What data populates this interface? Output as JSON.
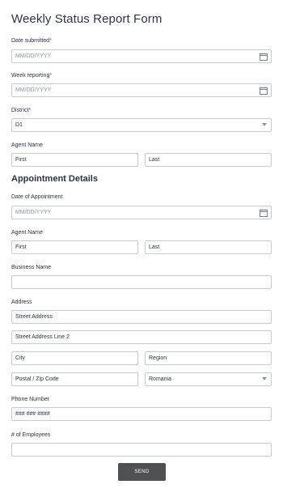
{
  "form": {
    "title": "Weekly Status Report Form",
    "section_title": "Appointment Details",
    "submit_label": "SEND"
  },
  "fields": {
    "date_submitted": {
      "label": "Date submitted",
      "required": "*",
      "placeholder": "MM/DD/YYYY"
    },
    "week_reporting": {
      "label": "Week reporting",
      "required": "*",
      "placeholder": "MM/DD/YYYY"
    },
    "district": {
      "label": "District",
      "required": "*",
      "value": "D1"
    },
    "agent_name": {
      "label": "Agent Name",
      "first": "First",
      "last": "Last"
    },
    "date_of_appointment": {
      "label": "Date of Appointment",
      "placeholder": "MM/DD/YYYY"
    },
    "agent_name_2": {
      "label": "Agent Name",
      "first": "First",
      "last": "Last"
    },
    "business_name": {
      "label": "Business Name",
      "value": ""
    },
    "address": {
      "label": "Address",
      "street": "Street Address",
      "street2": "Street Address Line 2",
      "city": "City",
      "region": "Region",
      "postal": "Postal / Zip Code",
      "country": "Romania"
    },
    "phone": {
      "label": "Phone Number",
      "placeholder": "### ### ####"
    },
    "employees": {
      "label": "# of Employees",
      "value": ""
    }
  },
  "icons": {
    "calendar": "calendar-icon",
    "dropdown": "chevron-down-icon"
  },
  "colors": {
    "required": "#d12f2f",
    "border": "#c3cad8",
    "button": "#4f5255"
  }
}
